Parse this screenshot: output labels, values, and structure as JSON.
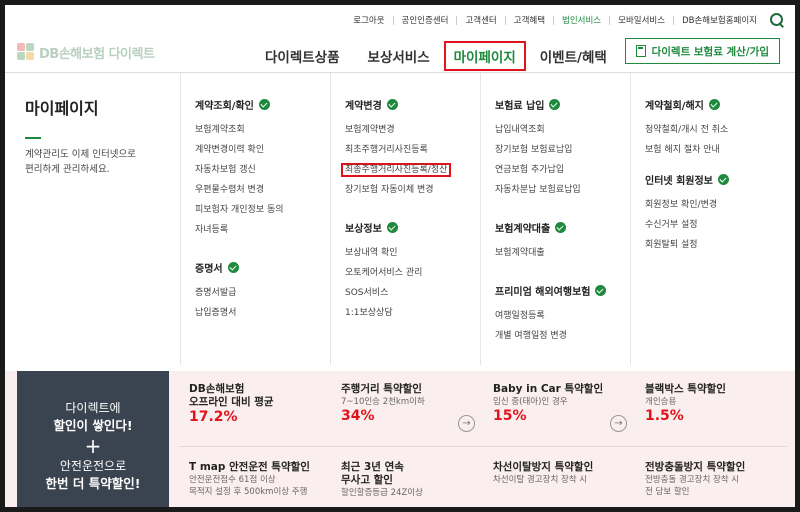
{
  "utility": [
    "로그아웃",
    "공인인증센터",
    "고객센터",
    "고객혜택",
    "법인서비스",
    "모바일서비스",
    "DB손해보험홈페이지"
  ],
  "logo": {
    "text": "DB손해보험 다이렉트"
  },
  "gnb": [
    "다이렉트상품",
    "보상서비스",
    "마이페이지",
    "이벤트/혜택"
  ],
  "calc_button": "다이렉트 보험료 계산/가입",
  "mypage": {
    "title": "마이페이지",
    "desc_1": "계약관리도 이제 인터넷으로",
    "desc_2": "편리하게 관리하세요."
  },
  "columns": {
    "c1g1": {
      "title": "계약조회/확인",
      "items": [
        "보험계약조회",
        "계약변경이력 확인",
        "자동차보험 갱신",
        "우편물수령처 변경",
        "피보험자 개인정보 동의",
        "자녀등록"
      ]
    },
    "c1g2": {
      "title": "증명서",
      "items": [
        "증명서발급",
        "납입증명서"
      ]
    },
    "c2g1": {
      "title": "계약변경",
      "items": [
        "보험계약변경",
        "최초주행거리사진등록",
        "최종주행거리사진등록/정산",
        "장기보험 자동이체 변경"
      ]
    },
    "c2g2": {
      "title": "보상정보",
      "items": [
        "보상내역 확인",
        "오토케어서비스 관리",
        "SOS서비스",
        "1:1보상상담"
      ]
    },
    "c3g1": {
      "title": "보험료 납입",
      "items": [
        "납입내역조회",
        "장기보험 보험료납입",
        "연금보험 추가납입",
        "자동차분납 보험료납입"
      ]
    },
    "c3g2": {
      "title": "보험계약대출",
      "items": [
        "보험계약대출"
      ]
    },
    "c3g3": {
      "title": "프리미엄 해외여행보험",
      "items": [
        "여행일정등록",
        "개별 여행일정 변경"
      ]
    },
    "c4g1": {
      "title": "계약철회/해지",
      "items": [
        "청약철회/개시 전 취소",
        "보험 해지 절차 안내"
      ]
    },
    "c4g2": {
      "title": "인터넷 회원정보",
      "items": [
        "회원정보 확인/변경",
        "수신거부 설정",
        "회원탈퇴 설정"
      ]
    }
  },
  "promo": {
    "left_1": "다이렉트에",
    "left_2": "할인이 쌓인다!",
    "left_plus": "+",
    "left_3": "안전운전으로",
    "left_4": "한번 더 특약할인!",
    "cells": [
      {
        "title": "DB손해보험",
        "title2": "오프라인 대비 평균",
        "sub": "",
        "pct": "17.2%"
      },
      {
        "title": "주행거리 특약할인",
        "title2": "",
        "sub": "7~10인승 2천km이하",
        "pct": "34%"
      },
      {
        "title": "Baby in Car 특약할인",
        "title2": "",
        "sub": "임신 중(태아)인 경우",
        "pct": "15%"
      },
      {
        "title": "블랙박스 특약할인",
        "title2": "",
        "sub": "개인승용",
        "pct": "1.5%"
      },
      {
        "title": "T map 안전운전 특약할인",
        "title2": "",
        "sub": "안전운전점수 61점 이상",
        "sub2": "목적지 설정 후 500km이상 주행"
      },
      {
        "title": "최근 3년 연속",
        "title2": "무사고 할인",
        "sub": "할인할증등급 24Z이상"
      },
      {
        "title": "차선이탈방지 특약할인",
        "title2": "",
        "sub": "차선이탈 경고장치 장착 시"
      },
      {
        "title": "전방충돌방지 특약할인",
        "title2": "",
        "sub": "전방충돌 경고장치 장착 시",
        "sub2": "전 담보 할인"
      }
    ]
  },
  "colors": {
    "green": "#1f8a3d",
    "highlight_red": "#e0151b",
    "banner_dark": "#3a4350"
  }
}
